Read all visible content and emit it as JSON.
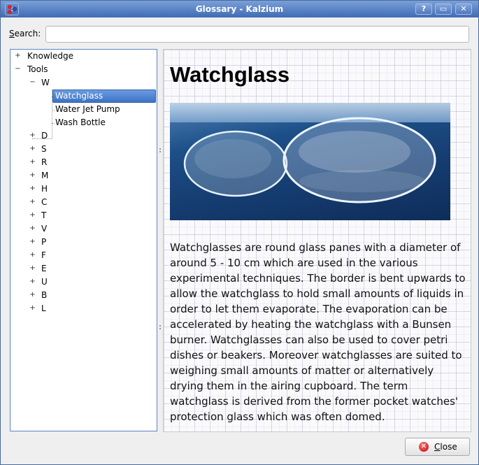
{
  "window": {
    "title": "Glossary - Kalzium",
    "buttons": {
      "help": "?",
      "maximize": "▭",
      "close": "✕"
    }
  },
  "search": {
    "label_mnemonic": "S",
    "label_rest": "earch:",
    "value": "",
    "placeholder": ""
  },
  "tree": {
    "knowledge": "Knowledge",
    "tools": "Tools",
    "group_w": "W",
    "w_items": [
      "Watchglass",
      "Water Jet Pump",
      "Wash Bottle"
    ],
    "other_groups": [
      "D",
      "S",
      "R",
      "M",
      "H",
      "C",
      "T",
      "V",
      "P",
      "F",
      "E",
      "U",
      "B",
      "L"
    ],
    "expand_glyph": "+",
    "collapse_glyph": "−"
  },
  "article": {
    "title": "Watchglass",
    "body": "Watchglasses are round glass panes with a diameter of around 5 - 10 cm which are used in the various experimental techniques. The border is bent upwards to allow the watchglass to hold small amounts of liquids in order to let them evaporate. The evaporation can be accelerated by heating the watchglass with a Bunsen burner. Watchglasses can also be used to cover petri dishes or beakers. Moreover watchglasses are suited to weighing small amounts of matter or alternatively drying them in the airing cupboard. The term watchglass is derived from the former pocket watches' protection glass which was often domed."
  },
  "footer": {
    "close_mnemonic": "C",
    "close_rest": "lose",
    "close_icon": "✕"
  },
  "colors": {
    "titlebar": "#3f6bb4",
    "selection": "#3d73c6",
    "tree_border": "#5b86c5"
  }
}
